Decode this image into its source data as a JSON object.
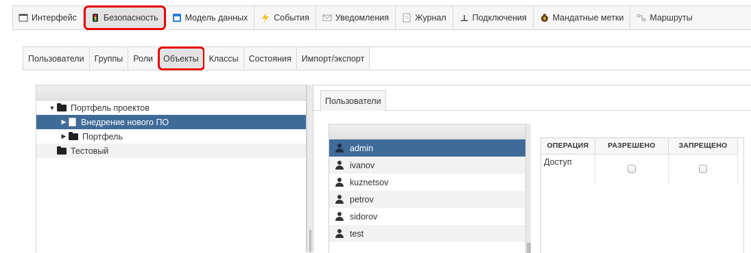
{
  "toolbar": {
    "items": [
      {
        "label": "Интерфейс",
        "icon": "window-icon"
      },
      {
        "label": "Безопасность",
        "icon": "traffic-light-icon"
      },
      {
        "label": "Модель данных",
        "icon": "data-model-icon"
      },
      {
        "label": "События",
        "icon": "lightning-icon"
      },
      {
        "label": "Уведомления",
        "icon": "envelope-icon"
      },
      {
        "label": "Журнал",
        "icon": "document-icon"
      },
      {
        "label": "Подключения",
        "icon": "plug-icon"
      },
      {
        "label": "Мандатные метки",
        "icon": "bug-icon"
      },
      {
        "label": "Маршруты",
        "icon": "route-icon"
      }
    ]
  },
  "subtabs": [
    "Пользователи",
    "Группы",
    "Роли",
    "Объекты",
    "Классы",
    "Состояния",
    "Импорт/экспорт"
  ],
  "tree": {
    "nodes": [
      {
        "label": "Портфель проектов",
        "toggle": "▼"
      },
      {
        "label": "Внедрение нового ПО",
        "toggle": "▶"
      },
      {
        "label": "Портфель",
        "toggle": "▶"
      },
      {
        "label": "Тестовый",
        "toggle": ""
      }
    ]
  },
  "right": {
    "tab": "Пользователи",
    "users": [
      "admin",
      "ivanov",
      "kuznetsov",
      "petrov",
      "sidorov",
      "test"
    ],
    "permissions": {
      "headers": [
        "ОПЕРАЦИЯ",
        "РАЗРЕШЕНО",
        "ЗАПРЕЩЕНО"
      ],
      "row_label": "Доступ"
    }
  },
  "colors": {
    "highlight": "#e60000",
    "selection": "#3f6b98"
  }
}
